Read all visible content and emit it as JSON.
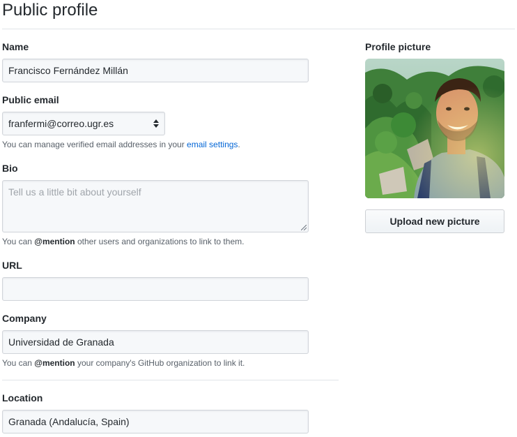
{
  "page": {
    "title": "Public profile"
  },
  "name": {
    "label": "Name",
    "value": "Francisco Fernández Millán"
  },
  "public_email": {
    "label": "Public email",
    "selected": "franfermi@correo.ugr.es",
    "note_prefix": "You can manage verified email addresses in your ",
    "note_link": "email settings",
    "note_suffix": "."
  },
  "bio": {
    "label": "Bio",
    "placeholder": "Tell us a little bit about yourself",
    "value": "",
    "note_prefix": "You can ",
    "note_mention": "@mention",
    "note_suffix": " other users and organizations to link to them."
  },
  "url": {
    "label": "URL",
    "value": ""
  },
  "company": {
    "label": "Company",
    "value": "Universidad de Granada",
    "note_prefix": "You can ",
    "note_mention": "@mention",
    "note_suffix": " your company's GitHub organization to link it."
  },
  "location": {
    "label": "Location",
    "value": "Granada (Andalucía, Spain)"
  },
  "profile_picture": {
    "label": "Profile picture",
    "upload_label": "Upload new picture"
  },
  "colors": {
    "link": "#0366d6",
    "input_bg": "#f6f8fa",
    "border": "#d1d5da",
    "text": "#24292e",
    "muted": "#586069"
  },
  "icons": {
    "select": "select-arrows-icon",
    "resize": "resize-handle-icon"
  }
}
